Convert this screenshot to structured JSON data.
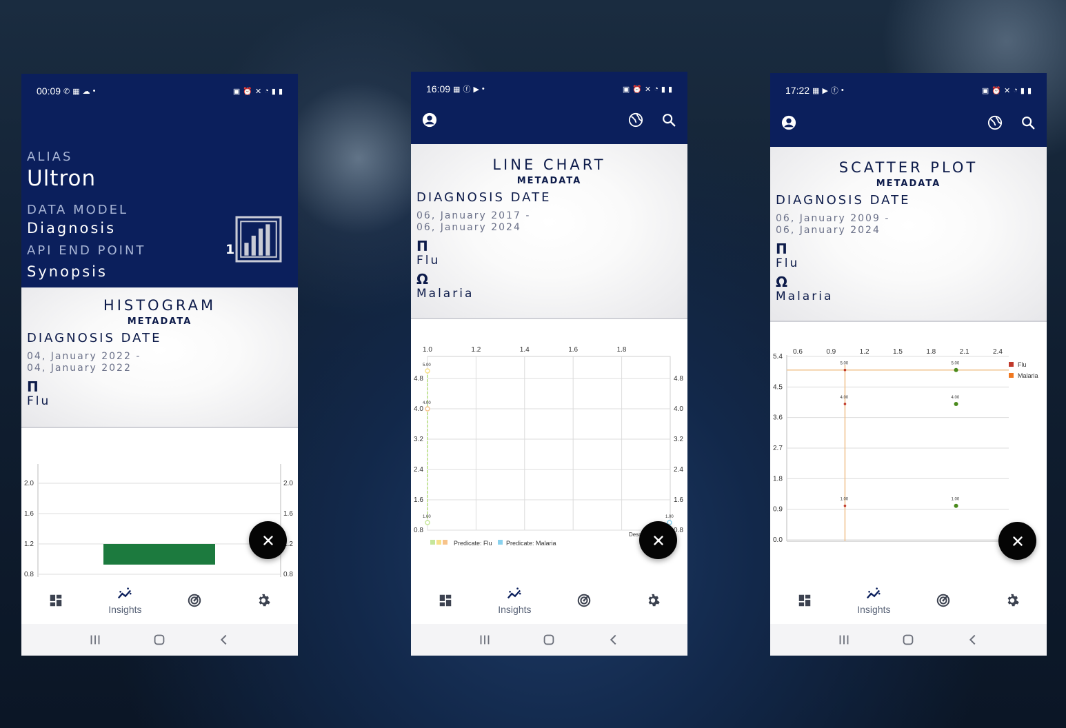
{
  "colors": {
    "navy": "#0b1f5c",
    "bar": "#1c7a3e",
    "flu_line": "#c6e69a",
    "flu_line2": "#f7e08a",
    "malaria": "#8ad2ee",
    "scatter_red": "#c0392b",
    "scatter_green": "#4a8a1c",
    "scatter_orange": "#f0c08a"
  },
  "screen1": {
    "status_time": "00:09",
    "alias_label": "ALIAS",
    "alias_value": "Ultron",
    "data_model_label": "DATA MODEL",
    "data_model_value": "Diagnosis",
    "api_label": "API END POINT",
    "api_value": "Synopsis",
    "badge_count": "1",
    "badge_icon": "bar-chart-icon",
    "meta": {
      "title": "HISTOGRAM",
      "subtitle": "METADATA",
      "key": "DIAGNOSIS DATE",
      "date_from": "04, January 2022 -",
      "date_to": "04, January 2022",
      "predicates": [
        {
          "symbol": "Π",
          "value": "Flu"
        }
      ]
    }
  },
  "screen2": {
    "status_time": "16:09",
    "meta": {
      "title": "LINE CHART",
      "subtitle": "METADATA",
      "key": "DIAGNOSIS DATE",
      "date_from": "06, January 2017 -",
      "date_to": "06, January 2024",
      "predicates": [
        {
          "symbol": "Π",
          "value": "Flu"
        },
        {
          "symbol": "Ω",
          "value": "Malaria"
        }
      ]
    },
    "axis_overflow_label": "Desc"
  },
  "screen3": {
    "status_time": "17:22",
    "meta": {
      "title": "SCATTER PLOT",
      "subtitle": "METADATA",
      "key": "DIAGNOSIS DATE",
      "date_from": "06, January 2009 -",
      "date_to": "06, January 2024",
      "predicates": [
        {
          "symbol": "Π",
          "value": "Flu"
        },
        {
          "symbol": "Ω",
          "value": "Malaria"
        }
      ]
    }
  },
  "nav": {
    "insights_label": "Insights"
  },
  "chart_data": [
    {
      "type": "bar",
      "ylim": [
        0.8,
        2.0
      ],
      "y_ticks": [
        "2.0",
        "1.6",
        "1.2",
        "0.8"
      ],
      "categories": [
        ""
      ],
      "values": [
        1
      ],
      "title": "",
      "xlabel": "",
      "ylabel": ""
    },
    {
      "type": "line",
      "xlim": [
        1.0,
        1.8
      ],
      "ylim": [
        0.8,
        4.8
      ],
      "x_ticks": [
        "1.0",
        "1.2",
        "1.4",
        "1.6",
        "1.8"
      ],
      "y_ticks": [
        "4.8",
        "4.0",
        "3.2",
        "2.4",
        "1.6",
        "0.8"
      ],
      "series": [
        {
          "name": "Predicate: Flu",
          "x": [
            1.0,
            1.0,
            1.0
          ],
          "y": [
            5.0,
            4.0,
            1.0
          ],
          "labels": [
            "5.00",
            "4.00",
            "1.00"
          ]
        },
        {
          "name": "Predicate: Malaria",
          "x": [
            2.0
          ],
          "y": [
            1.0
          ],
          "labels": [
            "1.00"
          ]
        }
      ],
      "title": "",
      "xlabel": "",
      "ylabel": ""
    },
    {
      "type": "scatter",
      "xlim": [
        0.6,
        2.4
      ],
      "ylim": [
        0.0,
        5.4
      ],
      "x_ticks": [
        "0.6",
        "0.9",
        "1.2",
        "1.5",
        "1.8",
        "2.1",
        "2.4"
      ],
      "y_ticks": [
        "5.4",
        "4.5",
        "3.6",
        "2.7",
        "1.8",
        "0.9",
        "0.0"
      ],
      "series": [
        {
          "name": "Flu",
          "x": [
            1.0,
            1.0,
            1.0
          ],
          "y": [
            5.0,
            4.0,
            1.0
          ],
          "labels": [
            "5.00",
            "4.00",
            "1.00"
          ]
        },
        {
          "name": "Malaria",
          "x": [
            2.0,
            2.0,
            2.0
          ],
          "y": [
            5.0,
            4.0,
            1.0
          ],
          "labels": [
            "5.00",
            "4.00",
            "1.00"
          ]
        }
      ],
      "legend": "top-right",
      "title": "",
      "xlabel": "",
      "ylabel": ""
    }
  ]
}
